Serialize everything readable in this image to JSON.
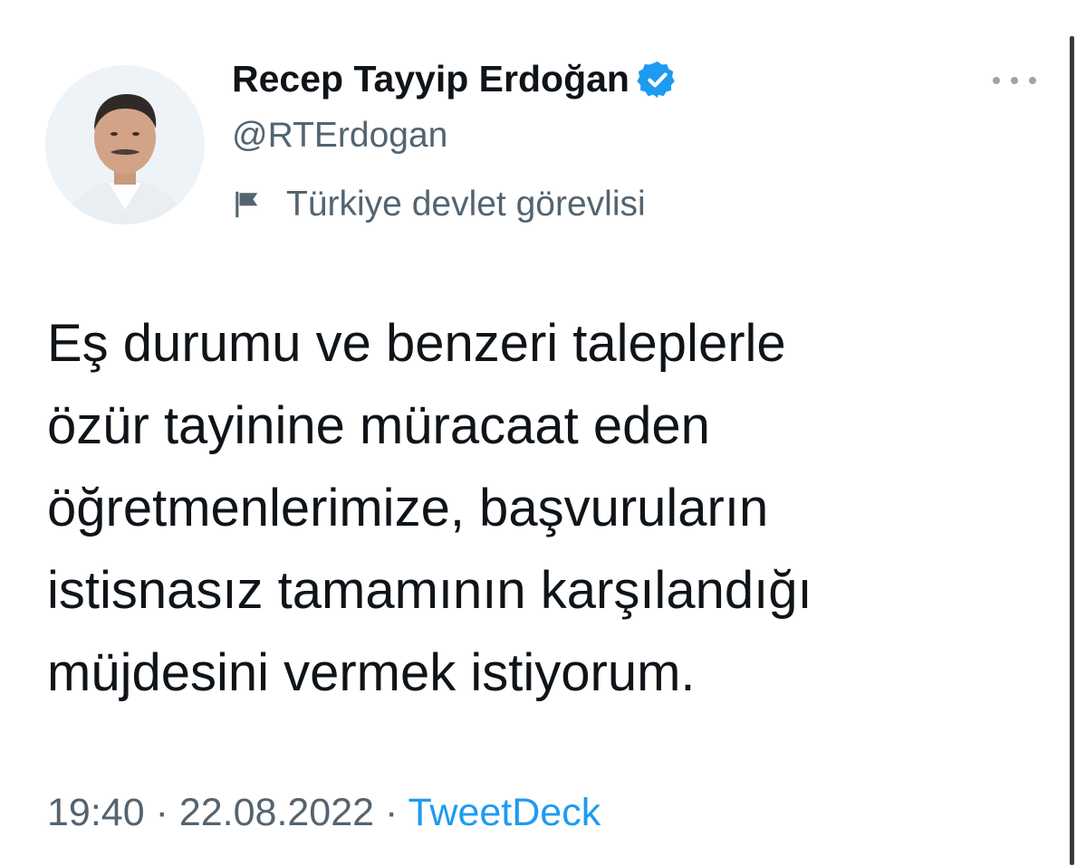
{
  "author": {
    "display_name": "Recep Tayyip Erdoğan",
    "handle": "@RTErdogan",
    "account_label": "Türkiye devlet görevlisi",
    "verified_color": "#1d9bf0",
    "avatar_icon": "profile-photo",
    "verified_icon": "verified-badge-icon",
    "label_icon": "flag-icon"
  },
  "tweet": {
    "text": "Eş durumu ve benzeri taleplerle\nözür tayinine müracaat eden\nöğretmenlerimize, başvuruların\nistisnasız tamamının karşılandığı\nmüjdesini vermek istiyorum.",
    "time": "19:40",
    "separator": "·",
    "date": "22.08.2022",
    "source": "TweetDeck"
  },
  "actions": {
    "more_icon": "more-options-icon"
  },
  "colors": {
    "text_primary": "#0f1419",
    "text_secondary": "#536471",
    "link": "#1d9bf0"
  }
}
